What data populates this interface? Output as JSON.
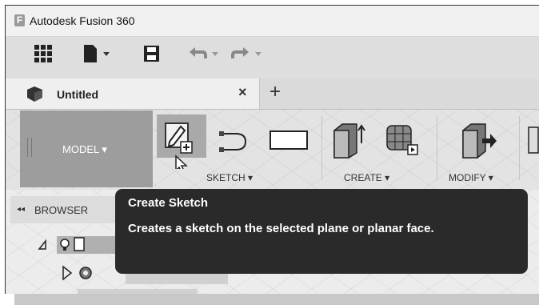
{
  "window": {
    "app_title": "Autodesk Fusion 360",
    "logo_letter": "F"
  },
  "toolbar": {
    "icons": [
      "grid-icon",
      "new-file-icon",
      "save-icon",
      "undo-icon",
      "redo-icon"
    ]
  },
  "tabs": {
    "document_tab_label": "Untitled",
    "close_symbol": "×",
    "add_symbol": "+"
  },
  "ribbon": {
    "workspace_label": "MODEL ▾",
    "groups": [
      {
        "label": "SKETCH ▾"
      },
      {
        "label": "CREATE ▾"
      },
      {
        "label": "MODIFY ▾"
      }
    ]
  },
  "browser": {
    "label": "BROWSER",
    "collapse_symbol": "◂◂"
  },
  "tooltip": {
    "title": "Create Sketch",
    "body": "Creates a sketch on the selected plane or planar face."
  },
  "colors": {
    "accent_dark": "#2a2a2a",
    "workspace_bg": "#9d9d9d"
  }
}
